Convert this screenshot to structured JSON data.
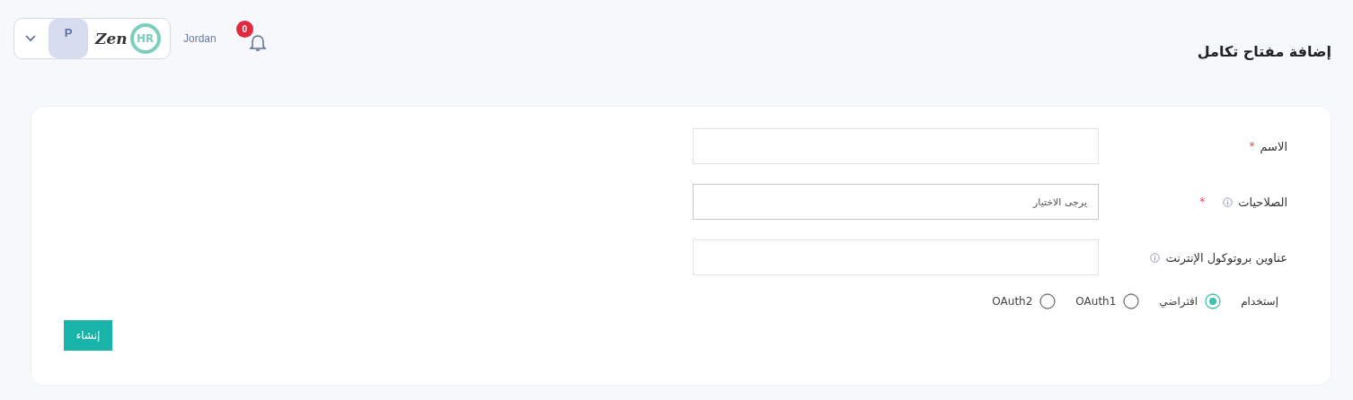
{
  "header": {
    "profile": {
      "initial": "P",
      "logo": {
        "word": "Zen",
        "badge": "HR"
      }
    },
    "country": "Jordan",
    "notifications": {
      "count": "0"
    }
  },
  "page_title": "إضافة مفتاح تكامل",
  "form": {
    "required_mark": "*",
    "fields": [
      {
        "kind": "input",
        "label": "الاسم",
        "required": true,
        "info": false
      },
      {
        "kind": "select",
        "label": "الصلاحيات",
        "required": true,
        "info": true,
        "placeholder": "يرجى الاختيار"
      },
      {
        "kind": "input",
        "label": "عناوين بروتوكول الإنترنت",
        "required": false,
        "info": true
      }
    ],
    "usage": {
      "label": "إستخدام",
      "options": [
        {
          "label": "افتراضي",
          "selected": true
        },
        {
          "label": "OAuth1",
          "selected": false
        },
        {
          "label": "OAuth2",
          "selected": false
        }
      ]
    },
    "submit": "إنشاء"
  }
}
